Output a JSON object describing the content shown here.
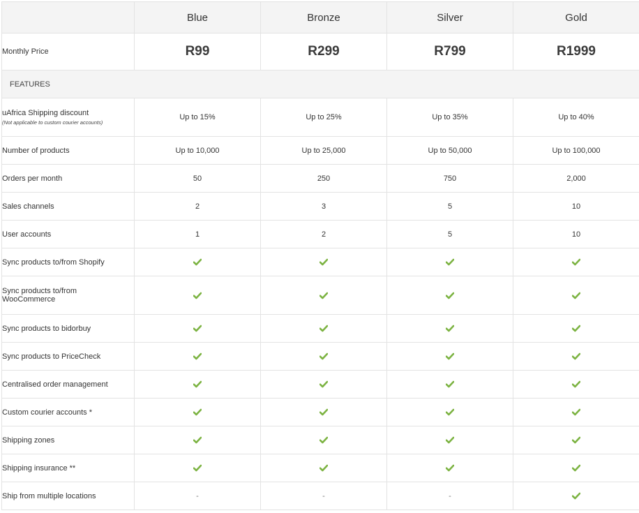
{
  "plans": [
    {
      "name": "Blue",
      "price": "R99"
    },
    {
      "name": "Bronze",
      "price": "R299"
    },
    {
      "name": "Silver",
      "price": "R799"
    },
    {
      "name": "Gold",
      "price": "R1999"
    }
  ],
  "price_row_label": "Monthly Price",
  "section_label": "FEATURES",
  "check_color": "#7cb342",
  "icons": {
    "included": "check-icon",
    "not_included": "dash"
  },
  "features": [
    {
      "label": "uAfrica Shipping discount",
      "note": "(Not applicable to custom courier accounts)",
      "values": [
        "Up to 15%",
        "Up to 25%",
        "Up to 35%",
        "Up to 40%"
      ]
    },
    {
      "label": "Number of products",
      "values": [
        "Up to 10,000",
        "Up to 25,000",
        "Up to 50,000",
        "Up to 100,000"
      ]
    },
    {
      "label": "Orders per month",
      "values": [
        "50",
        "250",
        "750",
        "2,000"
      ]
    },
    {
      "label": "Sales channels",
      "values": [
        "2",
        "3",
        "5",
        "10"
      ]
    },
    {
      "label": "User accounts",
      "values": [
        "1",
        "2",
        "5",
        "10"
      ]
    },
    {
      "label": "Sync products to/from Shopify",
      "values": [
        true,
        true,
        true,
        true
      ]
    },
    {
      "label": "Sync products to/from WooCommerce",
      "values": [
        true,
        true,
        true,
        true
      ]
    },
    {
      "label": "Sync products to bidorbuy",
      "values": [
        true,
        true,
        true,
        true
      ]
    },
    {
      "label": "Sync products to PriceCheck",
      "values": [
        true,
        true,
        true,
        true
      ]
    },
    {
      "label": "Centralised order management",
      "values": [
        true,
        true,
        true,
        true
      ]
    },
    {
      "label": "Custom courier accounts *",
      "values": [
        true,
        true,
        true,
        true
      ]
    },
    {
      "label": "Shipping zones",
      "values": [
        true,
        true,
        true,
        true
      ]
    },
    {
      "label": "Shipping insurance **",
      "values": [
        true,
        true,
        true,
        true
      ]
    },
    {
      "label": "Ship from multiple locations",
      "values": [
        "-",
        "-",
        "-",
        true
      ]
    }
  ]
}
